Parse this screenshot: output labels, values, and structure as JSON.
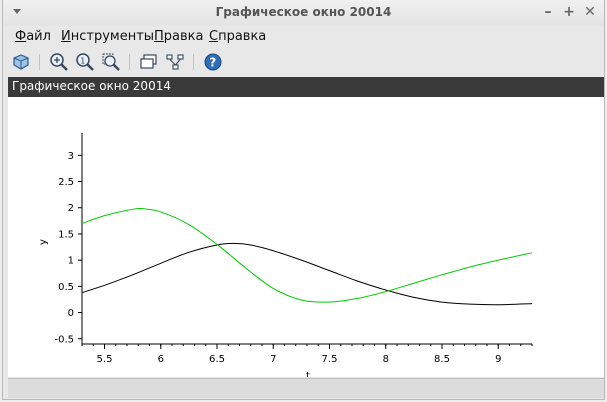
{
  "window": {
    "title": "Графическое окно 20014"
  },
  "menu": [
    {
      "mnemonic": "Ф",
      "rest": "айл"
    },
    {
      "mnemonic": "И",
      "rest": "нструменты"
    },
    {
      "mnemonic": "П",
      "rest": "равка"
    },
    {
      "mnemonic": "С",
      "rest": "правка"
    }
  ],
  "toolbar": {
    "icons": [
      "rotate-icon",
      "zoom-in-icon",
      "zoom-reset-icon",
      "zoom-area-icon",
      "datatip-icon",
      "editor-icon",
      "help-icon"
    ]
  },
  "figure": {
    "title": "Графическое окно 20014"
  },
  "colors": {
    "series_black": "#000000",
    "series_green": "#00cc00",
    "figure_bar": "#3a3a3a"
  },
  "chart_data": {
    "type": "line",
    "xlabel": "t",
    "ylabel": "y",
    "xlim": [
      5.3,
      9.3
    ],
    "ylim": [
      -0.6,
      3.35
    ],
    "xticks": [
      5.5,
      6,
      6.5,
      7,
      7.5,
      8,
      8.5,
      9
    ],
    "yticks": [
      -0.5,
      0,
      0.5,
      1,
      1.5,
      2,
      2.5,
      3
    ],
    "grid": false,
    "series": [
      {
        "color": "#000000",
        "x": [
          5.3,
          5.5,
          5.75,
          6.0,
          6.25,
          6.5,
          6.65,
          6.8,
          7.0,
          7.25,
          7.5,
          7.75,
          8.0,
          8.25,
          8.5,
          8.75,
          9.0,
          9.3
        ],
        "y": [
          0.38,
          0.52,
          0.72,
          0.94,
          1.15,
          1.29,
          1.32,
          1.29,
          1.18,
          1.0,
          0.8,
          0.6,
          0.43,
          0.29,
          0.2,
          0.16,
          0.15,
          0.17
        ]
      },
      {
        "color": "#00cc00",
        "x": [
          5.3,
          5.5,
          5.75,
          5.85,
          6.0,
          6.25,
          6.5,
          6.75,
          7.0,
          7.25,
          7.5,
          7.75,
          8.0,
          8.25,
          8.5,
          8.75,
          9.0,
          9.3
        ],
        "y": [
          1.7,
          1.85,
          1.97,
          1.98,
          1.92,
          1.68,
          1.3,
          0.86,
          0.46,
          0.24,
          0.2,
          0.27,
          0.4,
          0.56,
          0.72,
          0.87,
          1.0,
          1.14
        ]
      }
    ]
  }
}
